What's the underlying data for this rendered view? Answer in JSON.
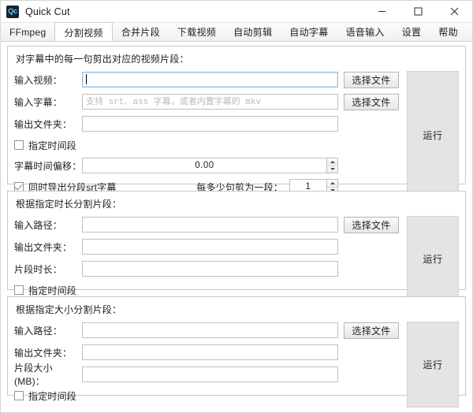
{
  "window": {
    "title": "Quick Cut",
    "icon_text": "Qc",
    "icon_bg": "#1c2235",
    "icon_fg": "#5fd3e8",
    "controls": {
      "minimize": "minimize-icon",
      "maximize": "maximize-icon",
      "close": "close-icon"
    }
  },
  "tabs": [
    {
      "label": "FFmpeg",
      "selected": false
    },
    {
      "label": "分割视频",
      "selected": true
    },
    {
      "label": "合并片段",
      "selected": false
    },
    {
      "label": "下载视频",
      "selected": false
    },
    {
      "label": "自动剪辑",
      "selected": false
    },
    {
      "label": "自动字幕",
      "selected": false
    },
    {
      "label": "语音输入",
      "selected": false
    },
    {
      "label": "设置",
      "selected": false
    },
    {
      "label": "帮助",
      "selected": false
    }
  ],
  "common": {
    "choose_file": "选择文件",
    "run": "运行",
    "specify_time_range": "指定时间段"
  },
  "group1": {
    "title": "对字幕中的每一句剪出对应的视频片段：",
    "input_video_label": "输入视频：",
    "input_video_value": "",
    "input_video_placeholder": "",
    "input_subtitle_label": "输入字幕：",
    "input_subtitle_value": "",
    "input_subtitle_placeholder": "支持 srt、ass 字幕，或者内置字幕的 mkv",
    "output_folder_label": "输出文件夹：",
    "output_folder_value": "",
    "specify_time_label": "指定时间段",
    "specify_time_checked": false,
    "time_offset_label": "字幕时间偏移：",
    "time_offset_value": "0.00",
    "export_srt_label": "同时导出分段srt字幕",
    "export_srt_checked": true,
    "sentences_per_clip_label": "每多少句剪为一段：",
    "sentences_per_clip_value": "1",
    "choose_file_1": "选择文件",
    "choose_file_2": "选择文件",
    "run": "运行"
  },
  "group2": {
    "title": "根据指定时长分割片段：",
    "input_path_label": "输入路径：",
    "input_path_value": "",
    "output_folder_label": "输出文件夹：",
    "output_folder_value": "",
    "clip_duration_label": "片段时长：",
    "clip_duration_value": "",
    "specify_time_label": "指定时间段",
    "specify_time_checked": false,
    "choose_file": "选择文件",
    "run": "运行"
  },
  "group3": {
    "title": "根据指定大小分割片段：",
    "input_path_label": "输入路径：",
    "input_path_value": "",
    "output_folder_label": "输出文件夹：",
    "output_folder_value": "",
    "clip_size_label": "片段大小(MB)：",
    "clip_size_value": "",
    "specify_time_label": "指定时间段",
    "specify_time_checked": false,
    "choose_file": "选择文件",
    "run": "运行"
  }
}
